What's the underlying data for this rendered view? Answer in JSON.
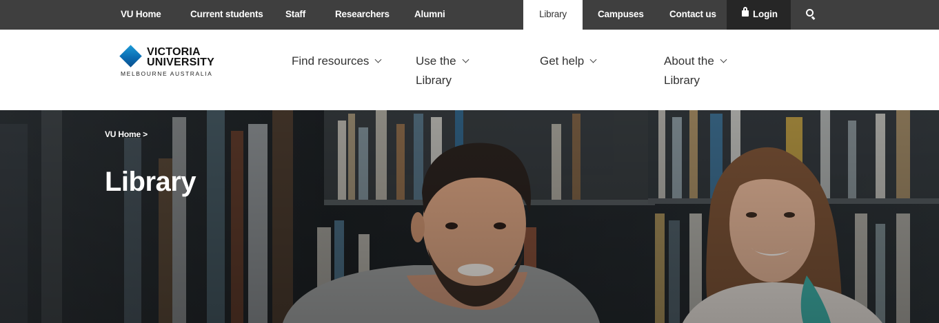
{
  "topbar": {
    "vu_home": "VU Home",
    "current_students": "Current students",
    "staff": "Staff",
    "researchers": "Researchers",
    "alumni": "Alumni",
    "library": "Library",
    "campuses": "Campuses",
    "contact_us": "Contact us",
    "login": "Login",
    "search_icon": "search-icon",
    "login_icon": "lock-icon"
  },
  "logo": {
    "line1": "VICTORIA",
    "line2": "UNIVERSITY",
    "line3": "MELBOURNE AUSTRALIA"
  },
  "nav": {
    "find_resources": "Find resources",
    "use_the_library": "Use the Library",
    "get_help": "Get help",
    "about_the_library": "About the Library"
  },
  "hero": {
    "breadcrumb": "VU Home >",
    "title": "Library"
  },
  "colors": {
    "topbar_bg": "#3f3f3f",
    "login_bg": "#262626",
    "brand_blue": "#1c9ad6"
  }
}
